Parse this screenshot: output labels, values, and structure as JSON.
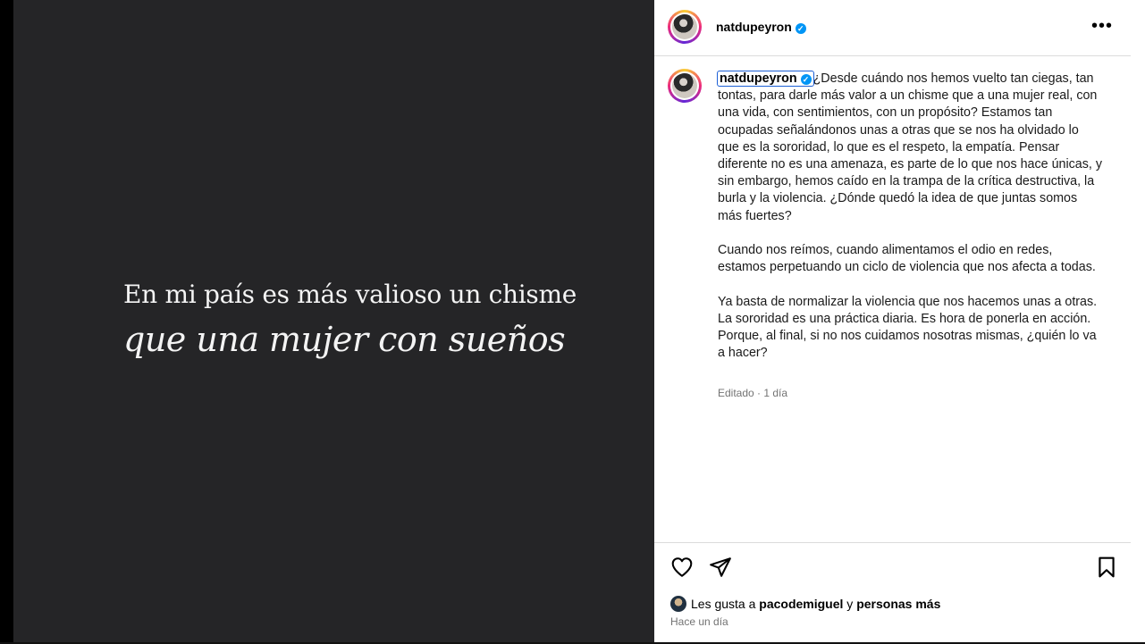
{
  "post_image": {
    "line1": "En mi país es más valioso un chisme",
    "line2": "que una mujer con sueños"
  },
  "header": {
    "username": "natdupeyron",
    "verified_icon": "verified-badge-icon",
    "more_icon": "more-options-icon"
  },
  "caption": {
    "username": "natdupeyron",
    "text": "¿Desde cuándo nos hemos vuelto tan ciegas, tan tontas, para darle más valor a un chisme que a una mujer real, con una vida, con sentimientos, con un propósito? Estamos tan ocupadas señalándonos unas a otras que se nos ha olvidado lo que es la sororidad, lo que es el respeto, la empatía. Pensar diferente no es una amenaza, es parte de lo que nos hace únicas, y sin embargo, hemos caído en la trampa de la crítica destructiva, la burla y la violencia. ¿Dónde quedó la idea de que juntas somos más fuertes?\n\nCuando nos reímos, cuando alimentamos el odio en redes, estamos perpetuando un ciclo de violencia que nos afecta a todas.\n\nYa basta de normalizar la violencia que nos hacemos unas a otras. La sororidad es una práctica diaria. Es hora de ponerla en acción. Porque, al final, si no nos cuidamos nosotras mismas, ¿quién lo va a hacer?",
    "meta": "Editado · 1 día"
  },
  "actions": {
    "like_icon": "heart-icon",
    "share_icon": "paper-plane-icon",
    "save_icon": "bookmark-icon"
  },
  "likes": {
    "prefix": "Les gusta a ",
    "user": "pacodemiguel",
    "middle": " y ",
    "others": "personas más"
  },
  "timestamp": "Hace un día",
  "colors": {
    "image_bg": "#252527",
    "verified": "#0095f6",
    "muted_text": "#737373"
  }
}
